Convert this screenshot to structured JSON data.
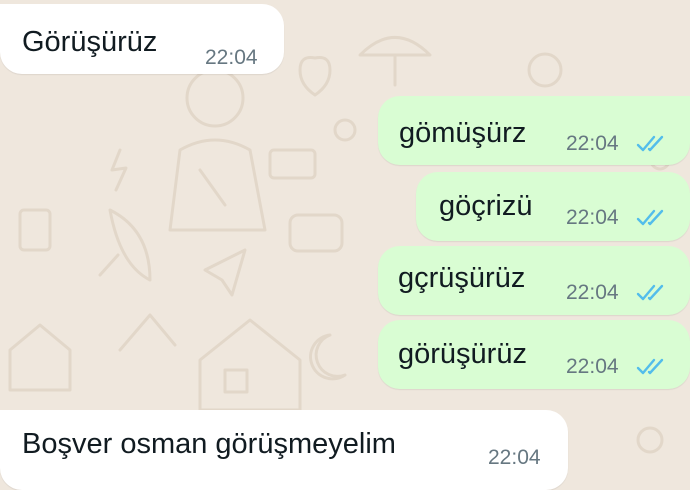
{
  "chat": {
    "messages": [
      {
        "direction": "incoming",
        "text": "Görüşürüz",
        "time": "22:04"
      },
      {
        "direction": "outgoing",
        "text": "gömüşürz",
        "time": "22:04",
        "status": "read",
        "status_icon": "double-check-icon"
      },
      {
        "direction": "outgoing",
        "text": "göçrizü",
        "time": "22:04",
        "status": "read",
        "status_icon": "double-check-icon"
      },
      {
        "direction": "outgoing",
        "text": "gçrüşürüz",
        "time": "22:04",
        "status": "read",
        "status_icon": "double-check-icon"
      },
      {
        "direction": "outgoing",
        "text": "görüşürüz",
        "time": "22:04",
        "status": "read",
        "status_icon": "double-check-icon"
      },
      {
        "direction": "incoming",
        "text": "Boşver osman görüşmeyelim",
        "time": "22:04"
      }
    ]
  },
  "colors": {
    "wallpaper": "#efe7dd",
    "incoming_bubble": "#ffffff",
    "outgoing_bubble": "#d9fdd3",
    "read_tick": "#53bdeb",
    "time_text": "#667781",
    "message_text": "#111b21"
  }
}
